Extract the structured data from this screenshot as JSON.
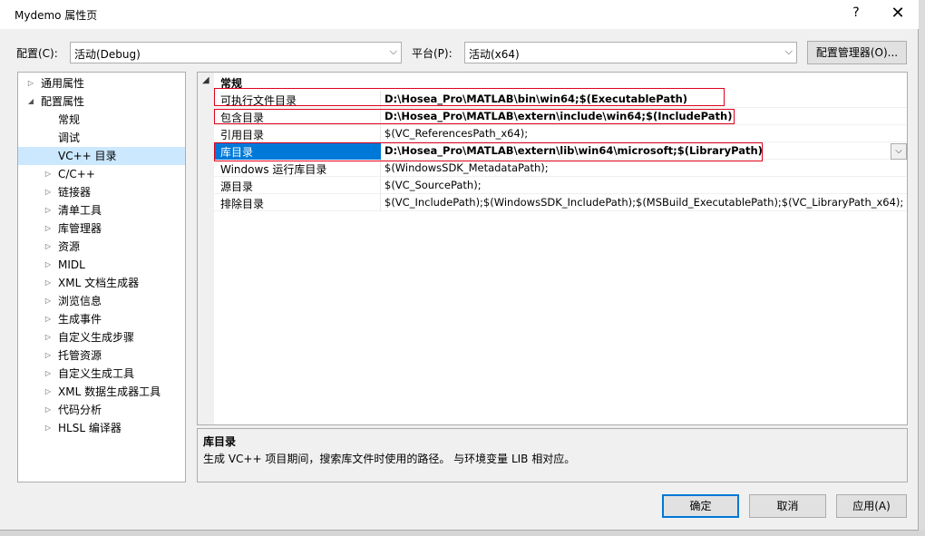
{
  "window": {
    "title": "Mydemo 属性页",
    "help": "?",
    "close": "✕"
  },
  "config": {
    "label": "配置(C):",
    "value": "活动(Debug)",
    "platform_label": "平台(P):",
    "platform_value": "活动(x64)",
    "manager_button": "配置管理器(O)..."
  },
  "tree": {
    "items": [
      {
        "label": "通用属性",
        "toggle": "▷"
      },
      {
        "label": "配置属性",
        "toggle": "◢"
      },
      {
        "label": "常规",
        "toggle": ""
      },
      {
        "label": "调试",
        "toggle": ""
      },
      {
        "label": "VC++ 目录",
        "toggle": ""
      },
      {
        "label": "C/C++",
        "toggle": "▷"
      },
      {
        "label": "链接器",
        "toggle": "▷"
      },
      {
        "label": "清单工具",
        "toggle": "▷"
      },
      {
        "label": "库管理器",
        "toggle": "▷"
      },
      {
        "label": "资源",
        "toggle": "▷"
      },
      {
        "label": "MIDL",
        "toggle": "▷"
      },
      {
        "label": "XML 文档生成器",
        "toggle": "▷"
      },
      {
        "label": "浏览信息",
        "toggle": "▷"
      },
      {
        "label": "生成事件",
        "toggle": "▷"
      },
      {
        "label": "自定义生成步骤",
        "toggle": "▷"
      },
      {
        "label": "托管资源",
        "toggle": "▷"
      },
      {
        "label": "自定义生成工具",
        "toggle": "▷"
      },
      {
        "label": "XML 数据生成器工具",
        "toggle": "▷"
      },
      {
        "label": "代码分析",
        "toggle": "▷"
      },
      {
        "label": "HLSL 编译器",
        "toggle": "▷"
      }
    ]
  },
  "grid": {
    "category": "常规",
    "category_toggle": "◢",
    "rows": [
      {
        "name": "可执行文件目录",
        "value": "D:\\Hosea_Pro\\MATLAB\\bin\\win64;$(ExecutablePath)"
      },
      {
        "name": "包含目录",
        "value": "D:\\Hosea_Pro\\MATLAB\\extern\\include\\win64;$(IncludePath)"
      },
      {
        "name": "引用目录",
        "value": "$(VC_ReferencesPath_x64);"
      },
      {
        "name": "库目录",
        "value": "D:\\Hosea_Pro\\MATLAB\\extern\\lib\\win64\\microsoft;$(LibraryPath)"
      },
      {
        "name": "Windows 运行库目录",
        "value": "$(WindowsSDK_MetadataPath);"
      },
      {
        "name": "源目录",
        "value": "$(VC_SourcePath);"
      },
      {
        "name": "排除目录",
        "value": "$(VC_IncludePath);$(WindowsSDK_IncludePath);$(MSBuild_ExecutablePath);$(VC_LibraryPath_x64);"
      }
    ]
  },
  "description": {
    "title": "库目录",
    "text": "生成 VC++ 项目期间，搜索库文件时使用的路径。 与环境变量 LIB 相对应。"
  },
  "buttons": {
    "ok": "确定",
    "cancel": "取消",
    "apply": "应用(A)"
  },
  "colors": {
    "selection": "#0078d7",
    "tree_selection": "#cce8ff",
    "highlight_box": "#e0001a"
  }
}
